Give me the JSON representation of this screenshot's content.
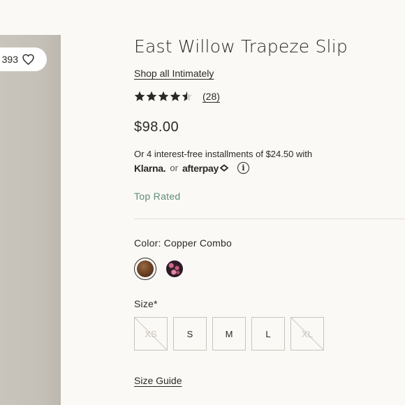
{
  "gallery": {
    "wishlist_count": "393",
    "wishlist_icon": "heart-outline-icon"
  },
  "product": {
    "title": "East Willow Trapeze Slip",
    "collection_link": "Shop all Intimately",
    "rating": 4.5,
    "rating_max": 5,
    "review_count": "(28)",
    "price": "$98.00",
    "installments_text": "Or 4 interest-free installments of $24.50 with",
    "klarna_label": "Klarna.",
    "or_label": "or",
    "afterpay_label": "afterpay",
    "info_icon": "info-circle-icon",
    "badge": "Top Rated",
    "badge_color": "#5e8c7a"
  },
  "color": {
    "label": "Color: Copper Combo",
    "swatches": [
      {
        "name": "Copper Combo",
        "selected": true
      },
      {
        "name": "floral",
        "selected": false
      }
    ]
  },
  "size": {
    "label": "Size*",
    "options": [
      {
        "label": "XS",
        "available": false
      },
      {
        "label": "S",
        "available": true
      },
      {
        "label": "M",
        "available": true
      },
      {
        "label": "L",
        "available": true
      },
      {
        "label": "XL",
        "available": false
      }
    ],
    "guide_link": "Size Guide"
  }
}
